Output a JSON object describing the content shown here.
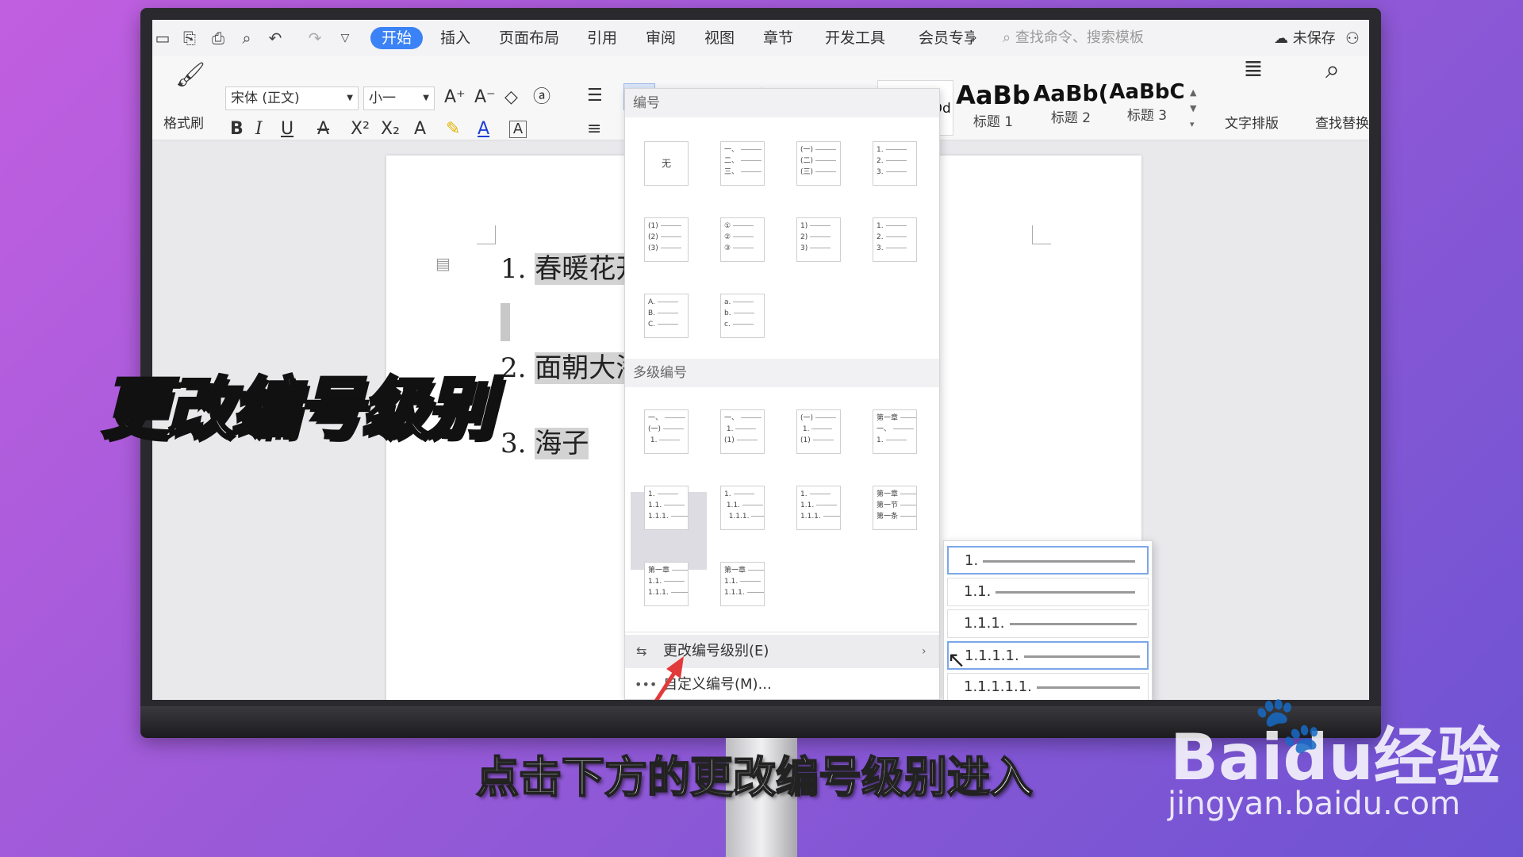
{
  "tabs": [
    "开始",
    "插入",
    "页面布局",
    "引用",
    "审阅",
    "视图",
    "章节",
    "开发工具",
    "会员专享"
  ],
  "search_placeholder": "查找命令、搜索模板",
  "save_status": "未保存",
  "ribbon": {
    "format_painter": "格式刷",
    "font_name": "宋体 (正文)",
    "font_size": "小一",
    "styles": [
      {
        "preview": "AaBbCcDd",
        "label": ""
      },
      {
        "preview": "AaBb",
        "label": "标题 1"
      },
      {
        "preview": "AaBb(",
        "label": "标题 2"
      },
      {
        "preview": "AaBbC",
        "label": "标题 3"
      }
    ],
    "text_layout": "文字排版",
    "find_replace": "查找替换"
  },
  "document": {
    "lines": [
      {
        "num": "1.",
        "text": "春暖花开"
      },
      {
        "num": "2.",
        "text": "面朝大海"
      },
      {
        "num": "3.",
        "text": "海子"
      }
    ]
  },
  "dropdown": {
    "numbering_header": "编号",
    "none_label": "无",
    "multilevel_header": "多级编号",
    "change_level": "更改编号级别(E)",
    "custom_numbering": "自定义编号(M)..."
  },
  "submenu": [
    "1.",
    "1.1.",
    "1.1.1.",
    "1.1.1.1.",
    "1.1.1.1.1."
  ],
  "caption_title": "更改编号级别",
  "subtitle": "点击下方的更改编号级别进入",
  "watermark": {
    "brand": "Baidu经验",
    "url": "jingyan.baidu.com"
  }
}
